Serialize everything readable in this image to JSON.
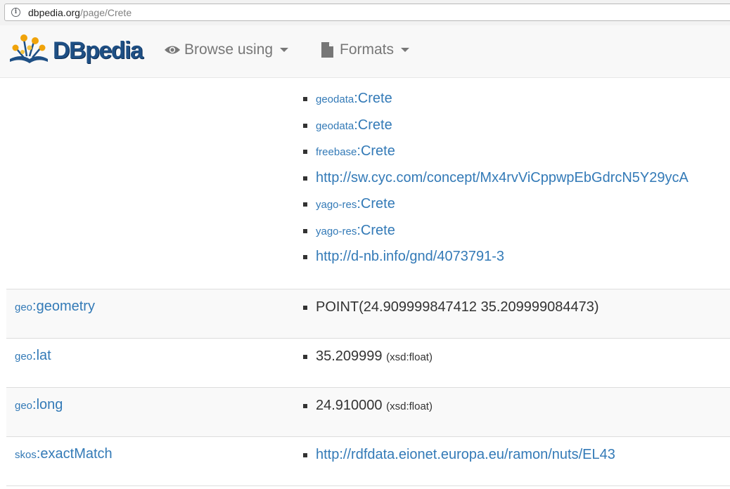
{
  "browser": {
    "url_host": "dbpedia.org",
    "url_path": "/page/Crete"
  },
  "navbar": {
    "logo_text": "DBpedia",
    "browse_label": "Browse using",
    "formats_label": "Formats"
  },
  "sameas_values": [
    {
      "prefix": "geodata",
      "name": "Crete"
    },
    {
      "prefix": "geodata",
      "name": "Crete"
    },
    {
      "prefix": "freebase",
      "name": "Crete"
    },
    {
      "prefix": "",
      "name": "http://sw.cyc.com/concept/Mx4rvViCppwpEbGdrcN5Y29ycA"
    },
    {
      "prefix": "yago-res",
      "name": "Crete"
    },
    {
      "prefix": "yago-res",
      "name": "Crete"
    },
    {
      "prefix": "",
      "name": "http://d-nb.info/gnd/4073791-3"
    }
  ],
  "rows": [
    {
      "prefix": "geo",
      "name": "geometry",
      "value": "POINT(24.909999847412 35.209999084473)",
      "dtype": ""
    },
    {
      "prefix": "geo",
      "name": "lat",
      "value": "35.209999",
      "dtype": "(xsd:float)"
    },
    {
      "prefix": "geo",
      "name": "long",
      "value": "24.910000",
      "dtype": "(xsd:float)"
    },
    {
      "prefix": "skos",
      "name": "exactMatch",
      "value": "http://rdfdata.eionet.europa.eu/ramon/nuts/EL43",
      "dtype": ""
    }
  ],
  "colors": {
    "link": "#337ab7",
    "navbar_bg": "#f8f8f8",
    "logo": "#1e4f84",
    "alt_row": "#f9f9f9"
  }
}
